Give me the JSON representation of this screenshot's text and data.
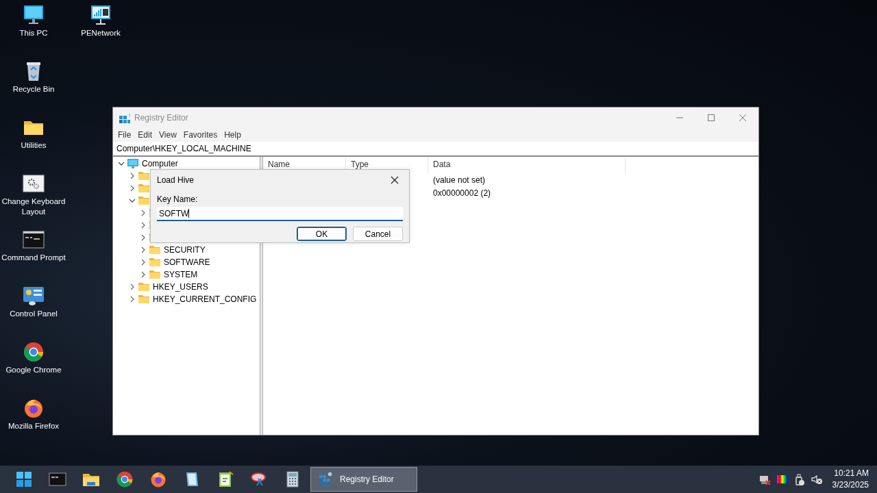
{
  "desktop_icons": [
    {
      "kind": "pc",
      "label": "This PC"
    },
    {
      "kind": "recycle",
      "label": "Recycle Bin"
    },
    {
      "kind": "folder",
      "label": "Utilities"
    },
    {
      "kind": "settings",
      "label": "Change Keyboard Layout"
    },
    {
      "kind": "cmd",
      "label": "Command Prompt"
    },
    {
      "kind": "control",
      "label": "Control Panel"
    },
    {
      "kind": "chrome",
      "label": "Google Chrome"
    },
    {
      "kind": "firefox",
      "label": "Mozilla Firefox"
    },
    {
      "kind": "network",
      "label": "PENetwork"
    }
  ],
  "window": {
    "title": "Registry Editor",
    "menu": [
      "File",
      "Edit",
      "View",
      "Favorites",
      "Help"
    ],
    "address": "Computer\\HKEY_LOCAL_MACHINE",
    "tree": [
      {
        "kind": "computer",
        "label": "Computer",
        "expanded": true,
        "children": [
          {
            "kind": "folder",
            "expanded": false
          },
          {
            "kind": "folder",
            "expanded": false
          },
          {
            "kind": "folder",
            "expanded": true,
            "children": [
              {
                "kind": "folder",
                "expanded": false
              },
              {
                "kind": "folder",
                "expanded": false
              },
              {
                "kind": "folder",
                "expanded": false
              },
              {
                "kind": "folder",
                "label": "SECURITY",
                "expanded": false
              },
              {
                "kind": "folder",
                "label": "SOFTWARE",
                "expanded": false
              },
              {
                "kind": "folder",
                "label": "SYSTEM",
                "expanded": false
              }
            ]
          },
          {
            "kind": "folder",
            "label": "HKEY_USERS",
            "expanded": false
          },
          {
            "kind": "folder",
            "label": "HKEY_CURRENT_CONFIG",
            "expanded": false
          }
        ]
      }
    ],
    "columns": [
      "Name",
      "Type",
      "Data"
    ],
    "rows": [
      {
        "data": "(value not set)"
      },
      {
        "data": "0x00000002 (2)"
      }
    ]
  },
  "dialog": {
    "title": "Load Hive",
    "field_label": "Key Name:",
    "value": "SOFTW",
    "buttons": [
      "OK",
      "Cancel"
    ]
  },
  "taskbar": {
    "items": [
      {
        "kind": "start",
        "selected": false
      },
      {
        "kind": "cmd",
        "selected": false
      },
      {
        "kind": "explorer",
        "selected": false
      },
      {
        "kind": "chrome",
        "selected": false
      },
      {
        "kind": "firefox",
        "selected": false
      },
      {
        "kind": "notepad",
        "selected": false
      },
      {
        "kind": "editor",
        "selected": false
      },
      {
        "kind": "snip",
        "selected": false
      },
      {
        "kind": "calculator",
        "selected": false
      },
      {
        "kind": "regedit",
        "label": "Registry Editor",
        "selected": true
      }
    ],
    "tray": [
      {
        "kind": "network"
      },
      {
        "kind": "color"
      },
      {
        "kind": "usb"
      },
      {
        "kind": "volume"
      }
    ],
    "time": "10:21 AM",
    "date": "3/23/2025"
  }
}
